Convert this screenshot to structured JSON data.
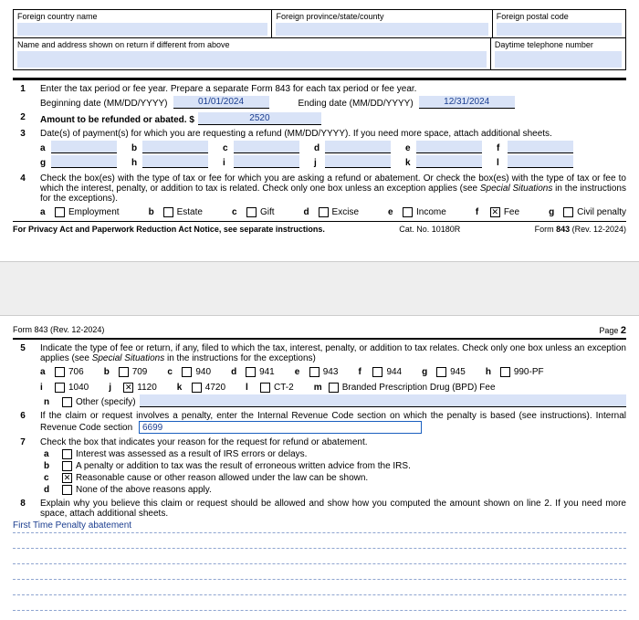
{
  "header": {
    "col1_label": "Foreign country name",
    "col2_label": "Foreign province/state/county",
    "col3_label": "Foreign postal code",
    "row2_col1_label": "Name and address shown on return if different from above",
    "row2_col2_label": "Daytime telephone number"
  },
  "line1": {
    "num": "1",
    "text": "Enter the tax period or fee year. Prepare a separate Form 843 for each tax period or fee year.",
    "begin_label": "Beginning date (MM/DD/YYYY)",
    "begin_value": "01/01/2024",
    "end_label": "Ending date (MM/DD/YYYY)",
    "end_value": "12/31/2024"
  },
  "line2": {
    "num": "2",
    "label": "Amount to be refunded or abated. $",
    "value": "2520"
  },
  "line3": {
    "num": "3",
    "text": "Date(s) of payment(s) for which you are requesting a refund (MM/DD/YYYY). If you need more space, attach additional sheets.",
    "labels": [
      "a",
      "b",
      "c",
      "d",
      "e",
      "f",
      "g",
      "h",
      "i",
      "j",
      "k",
      "l"
    ]
  },
  "line4": {
    "num": "4",
    "text": "Check the box(es) with the type of tax or fee for which you are asking a refund or abatement. Or check the box(es) with the type of tax or fee to which the interest, penalty, or addition to tax is related. Check only one box unless an exception applies (see ",
    "text_italic": "Special Situations",
    "text_end": " in the instructions for the exceptions).",
    "options": [
      {
        "letter": "a",
        "label": "Employment",
        "checked": false
      },
      {
        "letter": "b",
        "label": "Estate",
        "checked": false
      },
      {
        "letter": "c",
        "label": "Gift",
        "checked": false
      },
      {
        "letter": "d",
        "label": "Excise",
        "checked": false
      },
      {
        "letter": "e",
        "label": "Income",
        "checked": false
      },
      {
        "letter": "f",
        "label": "Fee",
        "checked": true
      },
      {
        "letter": "g",
        "label": "Civil penalty",
        "checked": false
      }
    ]
  },
  "footer1": {
    "left": "For Privacy Act and Paperwork Reduction Act Notice, see separate instructions.",
    "center": "Cat. No. 10180R",
    "right_pre": "Form ",
    "right_bold": "843",
    "right_post": " (Rev. 12-2024)"
  },
  "page2header": {
    "left": "Form 843 (Rev. 12-2024)",
    "right_pre": "Page ",
    "right_bold": "2"
  },
  "line5": {
    "num": "5",
    "text": "Indicate the type of fee or return, if any, filed to which the tax, interest, penalty, or addition to tax relates. Check only one box unless an exception applies (see ",
    "text_italic": "Special Situations",
    "text_end": " in the instructions for the exceptions)",
    "options": [
      {
        "letter": "a",
        "label": "706",
        "checked": false
      },
      {
        "letter": "b",
        "label": "709",
        "checked": false
      },
      {
        "letter": "c",
        "label": "940",
        "checked": false
      },
      {
        "letter": "d",
        "label": "941",
        "checked": false
      },
      {
        "letter": "e",
        "label": "943",
        "checked": false
      },
      {
        "letter": "f",
        "label": "944",
        "checked": false
      },
      {
        "letter": "g",
        "label": "945",
        "checked": false
      },
      {
        "letter": "h",
        "label": "990-PF",
        "checked": false
      },
      {
        "letter": "i",
        "label": "1040",
        "checked": false
      },
      {
        "letter": "j",
        "label": "1120",
        "checked": true
      },
      {
        "letter": "k",
        "label": "4720",
        "checked": false
      },
      {
        "letter": "l",
        "label": "CT-2",
        "checked": false
      },
      {
        "letter": "m",
        "label": "Branded Prescription Drug (BPD) Fee",
        "checked": false
      }
    ],
    "other_letter": "n",
    "other_label": "Other (specify)"
  },
  "line6": {
    "num": "6",
    "text_pre": "If the claim or request involves a penalty, enter the Internal Revenue Code section on which the penalty is based (see instructions). Internal Revenue Code section",
    "value": "6699"
  },
  "line7": {
    "num": "7",
    "text": "Check the box that indicates your reason for the request for refund or abatement.",
    "reasons": [
      {
        "letter": "a",
        "label": "Interest was assessed as a result of IRS errors or delays.",
        "checked": false
      },
      {
        "letter": "b",
        "label": "A penalty or addition to tax was the result of erroneous written advice from the IRS.",
        "checked": false
      },
      {
        "letter": "c",
        "label": "Reasonable cause or other reason allowed under the law can be shown.",
        "checked": true
      },
      {
        "letter": "d",
        "label": "None of the above reasons apply.",
        "checked": false
      }
    ]
  },
  "line8": {
    "num": "8",
    "text": "Explain why you believe this claim or request should be allowed and show how you computed the amount shown on line 2. If you need more space, attach additional sheets.",
    "explanation": "First Time Penalty abatement"
  }
}
